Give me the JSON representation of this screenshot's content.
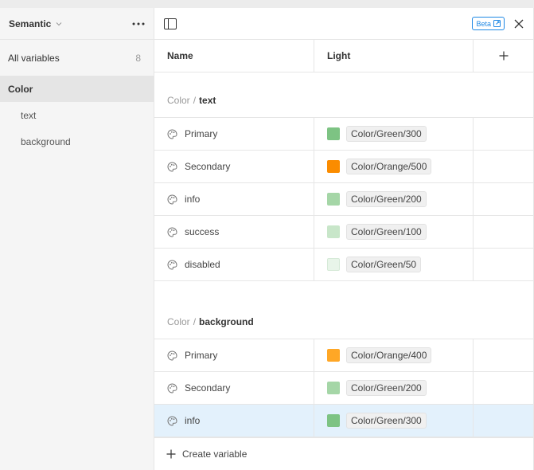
{
  "sidebar": {
    "collection_name": "Semantic",
    "all_variables": {
      "label": "All variables",
      "count": "8"
    },
    "group": {
      "label": "Color"
    },
    "children": [
      {
        "label": "text"
      },
      {
        "label": "background"
      }
    ]
  },
  "toolbar": {
    "beta_label": "Beta"
  },
  "table": {
    "headers": {
      "name": "Name",
      "mode": "Light"
    }
  },
  "groups": [
    {
      "prefix": "Color",
      "separator": "/",
      "name": "text",
      "rows": [
        {
          "name": "Primary",
          "alias": "Color/Green/300",
          "swatch": "#7dc383"
        },
        {
          "name": "Secondary",
          "alias": "Color/Orange/500",
          "swatch": "#fb8c00"
        },
        {
          "name": "info",
          "alias": "Color/Green/200",
          "swatch": "#a5d6a7"
        },
        {
          "name": "success",
          "alias": "Color/Green/100",
          "swatch": "#c8e6c9"
        },
        {
          "name": "disabled",
          "alias": "Color/Green/50",
          "swatch": "#e8f5e9"
        }
      ]
    },
    {
      "prefix": "Color",
      "separator": "/",
      "name": "background",
      "rows": [
        {
          "name": "Primary",
          "alias": "Color/Orange/400",
          "swatch": "#ffa726"
        },
        {
          "name": "Secondary",
          "alias": "Color/Green/200",
          "swatch": "#a5d6a7"
        },
        {
          "name": "info",
          "alias": "Color/Green/300",
          "swatch": "#7dc383",
          "selected": true
        }
      ]
    }
  ],
  "footer": {
    "create_label": "Create variable"
  },
  "colors": {
    "accent": "#1e88e5",
    "selected_row": "#e3f1fc"
  }
}
